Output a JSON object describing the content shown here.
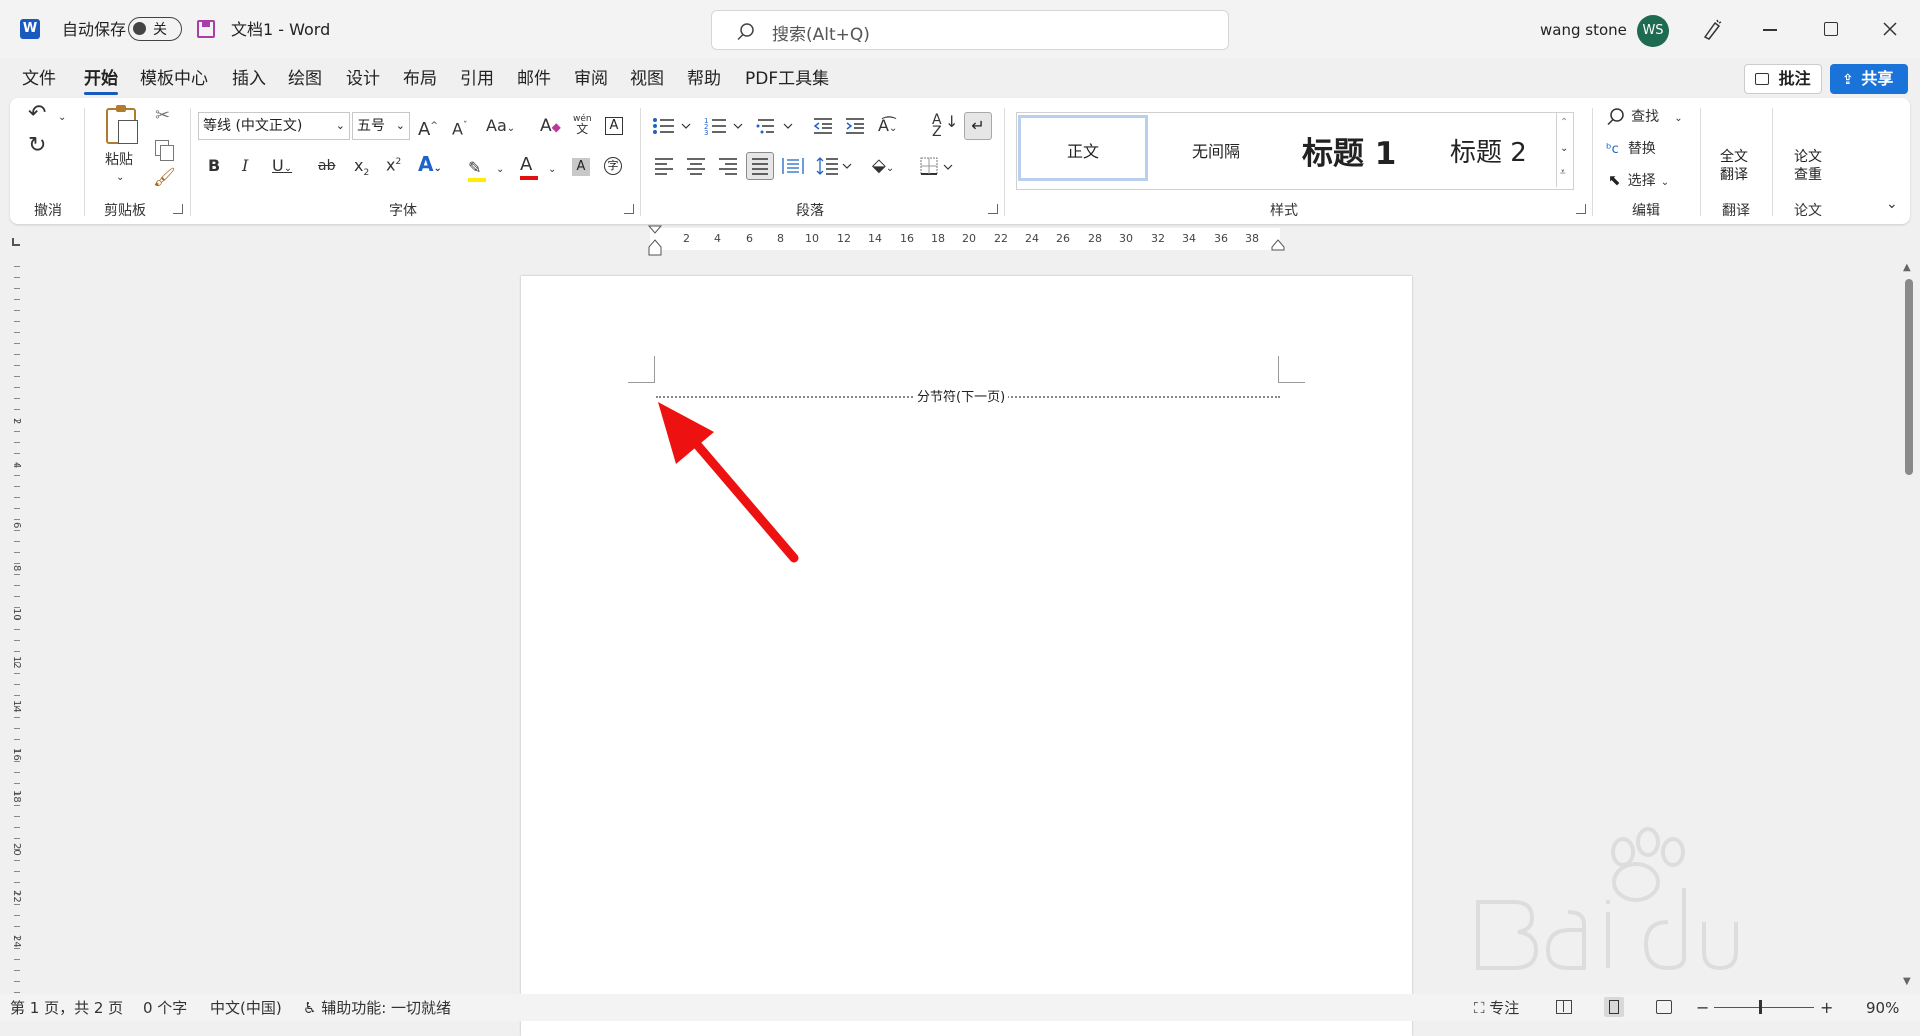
{
  "titlebar": {
    "autosave_label": "自动保存",
    "autosave_state": "关",
    "doc_title": "文档1  -  Word",
    "search_placeholder": "搜索(Alt+Q)",
    "user_name": "wang stone",
    "user_initials": "WS"
  },
  "menu": {
    "tabs": [
      "文件",
      "开始",
      "模板中心",
      "插入",
      "绘图",
      "设计",
      "布局",
      "引用",
      "邮件",
      "审阅",
      "视图",
      "帮助",
      "PDF工具集"
    ],
    "active_tab": "开始",
    "comment_label": "批注",
    "share_label": "共享"
  },
  "ribbon": {
    "groups": {
      "undo": "撤消",
      "clipboard": "剪贴板",
      "font": "字体",
      "paragraph": "段落",
      "styles": "样式",
      "editing": "编辑",
      "translate": "翻译",
      "paper": "论文"
    },
    "paste_label": "粘贴",
    "font_name": "等线 (中文正文)",
    "font_size": "五号",
    "font_buttons": {
      "bold": "B",
      "italic": "I",
      "underline": "U",
      "strike": "ab",
      "sub": "x₂",
      "sup": "x²",
      "case": "Aa",
      "grow": "A^",
      "shrink": "Aˇ",
      "phonetic": "wén 文"
    },
    "styles": [
      "正文",
      "无间隔",
      "标题 1",
      "标题 2"
    ],
    "editing": {
      "find": "查找",
      "replace": "替换",
      "select": "选择"
    },
    "translate_label_1": "全文",
    "translate_label_2": "翻译",
    "paper_label_1": "论文",
    "paper_label_2": "查重"
  },
  "ruler": {
    "top_numbers": [
      "2",
      "4",
      "6",
      "8",
      "10",
      "12",
      "14",
      "16",
      "18",
      "20",
      "22",
      "24",
      "26",
      "28",
      "30",
      "32",
      "34",
      "36",
      "38"
    ],
    "left_numbers": [
      "2",
      "4",
      "6",
      "8",
      "10",
      "12",
      "14",
      "16",
      "18",
      "20",
      "22",
      "24"
    ]
  },
  "document": {
    "section_break_label": "分节符(下一页)"
  },
  "statusbar": {
    "page_info": "第 1 页，共 2 页",
    "word_count": "0 个字",
    "language": "中文(中国)",
    "accessibility": "辅助功能: 一切就绪",
    "focus": "专注",
    "zoom": "90%"
  },
  "colors": {
    "accent": "#185abd",
    "share_button": "#1a73d9",
    "annotation_arrow": "#ee1111",
    "avatar": "#1e6b52"
  }
}
